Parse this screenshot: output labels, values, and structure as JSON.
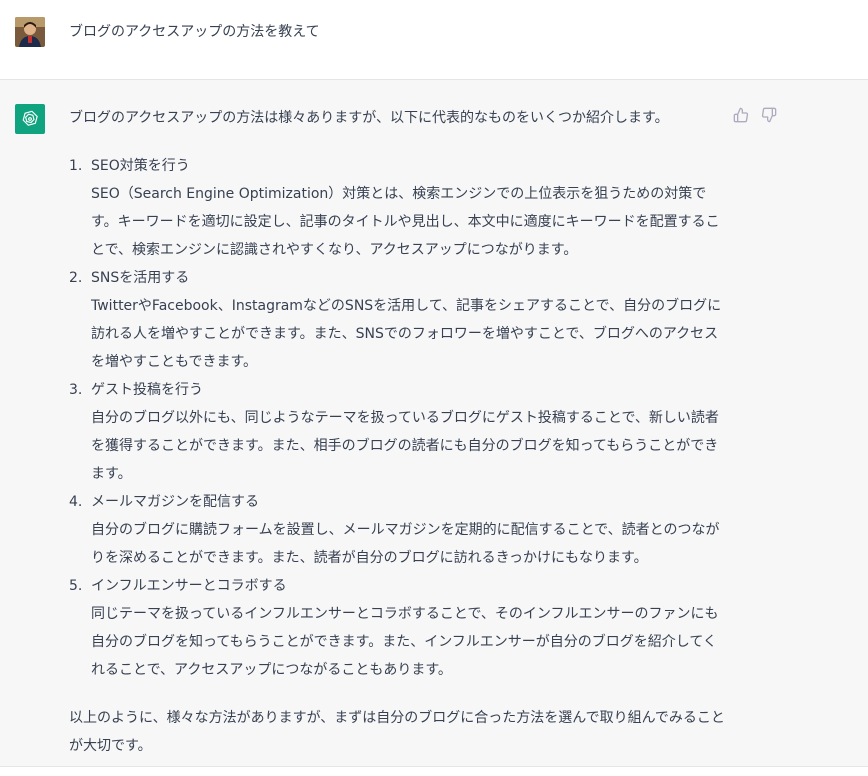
{
  "colors": {
    "bot_avatar_bg": "#10a37f",
    "bot_row_bg": "#f7f7f8",
    "text": "#374151",
    "icon": "#acacbe"
  },
  "icons": {
    "user_avatar": "user-avatar-photo",
    "bot_avatar": "openai-logo-icon",
    "like": "thumbs-up-icon",
    "dislike": "thumbs-down-icon"
  },
  "user_message": {
    "text": "ブログのアクセスアップの方法を教えて"
  },
  "assistant_message": {
    "intro": "ブログのアクセスアップの方法は様々ありますが、以下に代表的なものをいくつか紹介します。",
    "items": [
      {
        "number": "1.",
        "title": "SEO対策を行う",
        "description": "SEO（Search Engine Optimization）対策とは、検索エンジンでの上位表示を狙うための対策です。キーワードを適切に設定し、記事のタイトルや見出し、本文中に適度にキーワードを配置することで、検索エンジンに認識されやすくなり、アクセスアップにつながります。"
      },
      {
        "number": "2.",
        "title": "SNSを活用する",
        "description": "TwitterやFacebook、InstagramなどのSNSを活用して、記事をシェアすることで、自分のブログに訪れる人を増やすことができます。また、SNSでのフォロワーを増やすことで、ブログへのアクセスを増やすこともできます。"
      },
      {
        "number": "3.",
        "title": "ゲスト投稿を行う",
        "description": "自分のブログ以外にも、同じようなテーマを扱っているブログにゲスト投稿することで、新しい読者を獲得することができます。また、相手のブログの読者にも自分のブログを知ってもらうことができます。"
      },
      {
        "number": "4.",
        "title": "メールマガジンを配信する",
        "description": "自分のブログに購読フォームを設置し、メールマガジンを定期的に配信することで、読者とのつながりを深めることができます。また、読者が自分のブログに訪れるきっかけにもなります。"
      },
      {
        "number": "5.",
        "title": "インフルエンサーとコラボする",
        "description": "同じテーマを扱っているインフルエンサーとコラボすることで、そのインフルエンサーのファンにも自分のブログを知ってもらうことができます。また、インフルエンサーが自分のブログを紹介してくれることで、アクセスアップにつながることもあります。"
      }
    ],
    "conclusion": "以上のように、様々な方法がありますが、まずは自分のブログに合った方法を選んで取り組んでみることが大切です。"
  }
}
